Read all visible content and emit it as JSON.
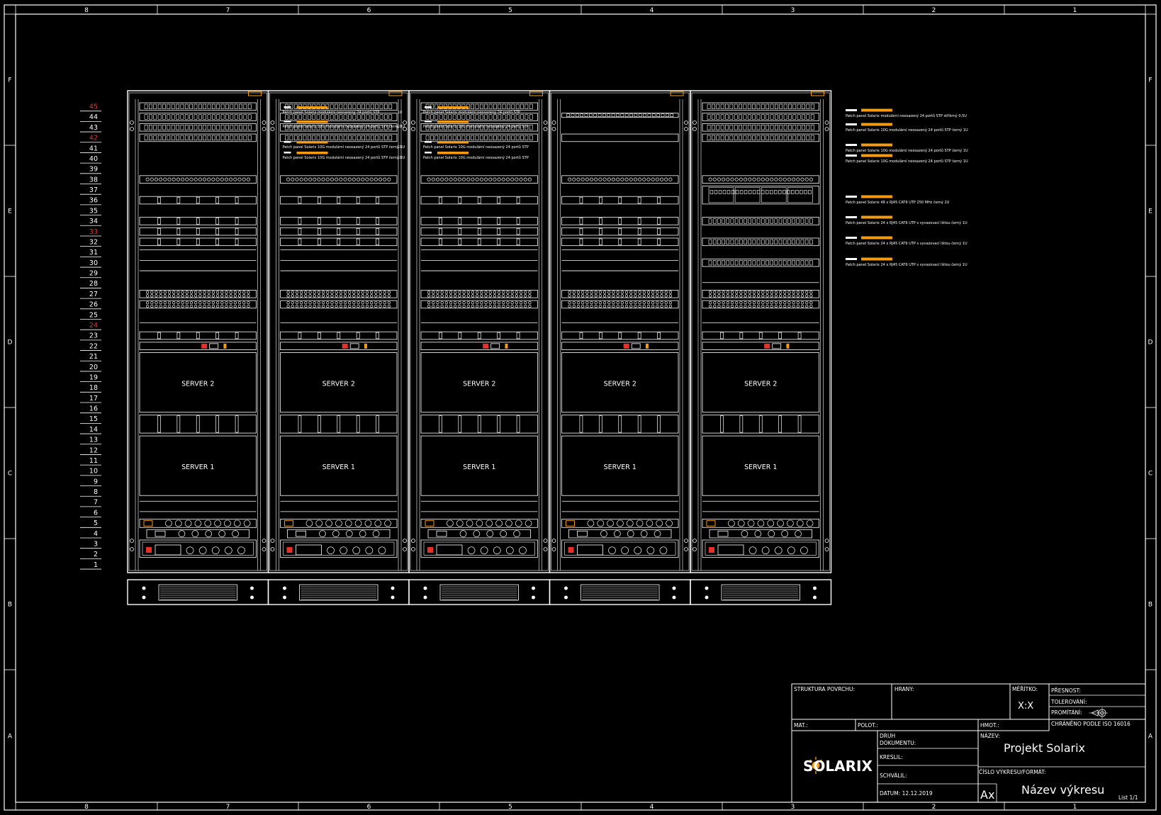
{
  "frame": {
    "columns": [
      "8",
      "7",
      "6",
      "5",
      "4",
      "3",
      "2",
      "1"
    ],
    "rows": [
      "F",
      "E",
      "D",
      "C",
      "B",
      "A"
    ]
  },
  "unit_numbers": [
    "45",
    "44",
    "43",
    "42",
    "41",
    "40",
    "39",
    "38",
    "37",
    "36",
    "35",
    "34",
    "33",
    "32",
    "31",
    "30",
    "29",
    "28",
    "27",
    "26",
    "25",
    "24",
    "23",
    "22",
    "21",
    "20",
    "19",
    "18",
    "17",
    "16",
    "15",
    "14",
    "13",
    "12",
    "11",
    "10",
    "9",
    "8",
    "7",
    "6",
    "5",
    "4",
    "3",
    "2",
    "1"
  ],
  "unit_numbers_highlighted": [
    "45",
    "42",
    "33",
    "24"
  ],
  "rack_labels": {
    "server_upper": "SERVER 2",
    "server_lower": "SERVER 1"
  },
  "rack_count": 5,
  "rack2_labels": [
    "Patch panel Solarix modulární neosazený 24 portů STP",
    "Patch panel Solarix 10G modulární neosazený 24 portů STP černý 1U",
    "Patch panel Solarix 10G modulární neosazený 24 portů STP černý 1U",
    "Patch panel Solarix 10G modulární neosazený 24 portů STP černý 1U"
  ],
  "rack2_side_suffixes": [
    "1U",
    "1U",
    "1U",
    "1U"
  ],
  "rack3_labels": [
    "Patch panel Solarix modulární neosazený 24 portů STP",
    "Patch panel Solarix 10G modulární neosazený 24 portů STP",
    "Patch panel Solarix 10G modulární neosazený 24 portů STP",
    "Patch panel Solarix 10G modulární neosazený 24 portů STP"
  ],
  "legend": [
    "Patch panel Solarix modulární neosazený 24 portů STP stříbrný 0,5U",
    "Patch panel Solarix 10G modulární neosazený 24 portů STP černý 1U",
    "Patch panel Solarix 10G modulární neosazený 24 portů STP černý 1U",
    "Patch panel Solarix 10G modulární neosazený 24 portů STP černý 1U",
    "Patch panel Solarix 48 x RJ45 CAT6 UTP 250 MHz černý 2U",
    "Patch panel Solarix 24 x RJ45 CAT6 UTP s vyvazovací lištou černý 1U",
    "Patch panel Solarix 24 x RJ45 CAT6 UTP s vyvazovací lištou černý 1U",
    "Patch panel Solarix 24 x RJ45 CAT6 UTP s vyvazovací lištou černý 1U"
  ],
  "title_block": {
    "struktura_povrchu": "STRUKTURA POVRCHU:",
    "hrany": "HRANY:",
    "meritko_label": "MĚŘÍTKO:",
    "meritko_value": "X:X",
    "presnost": "PŘESNOST:",
    "tolerovani": "TOLEROVÁNÍ:",
    "promitani": "PROMÍTÁNÍ:",
    "chraneno": "CHRÁNĚNO PODLE ISO 16016",
    "mat": "MAT.:",
    "polot": "POLOT.:",
    "hmot": "HMOT.:",
    "druh_dokumentu": "DRUH DOKUMENTU:",
    "kreslil": "KRESLIL:",
    "schvalil": "SCHVÁLIL:",
    "datum": "DATUM: 12.12.2019",
    "nazev_label": "NÁZEV:",
    "nazev_value": "Projekt Solarix",
    "cislo_label": "ČÍSLO VÝKRESU/FORMÁT:",
    "format_value": "Ax",
    "nazev_vykresu": "Název výkresu",
    "list": "List 1/1",
    "logo_text": "SOLARIX"
  },
  "colors": {
    "background": "#000000",
    "line": "#ffffff",
    "accent_orange": "#f39c12",
    "highlight_red": "#e8302a"
  }
}
